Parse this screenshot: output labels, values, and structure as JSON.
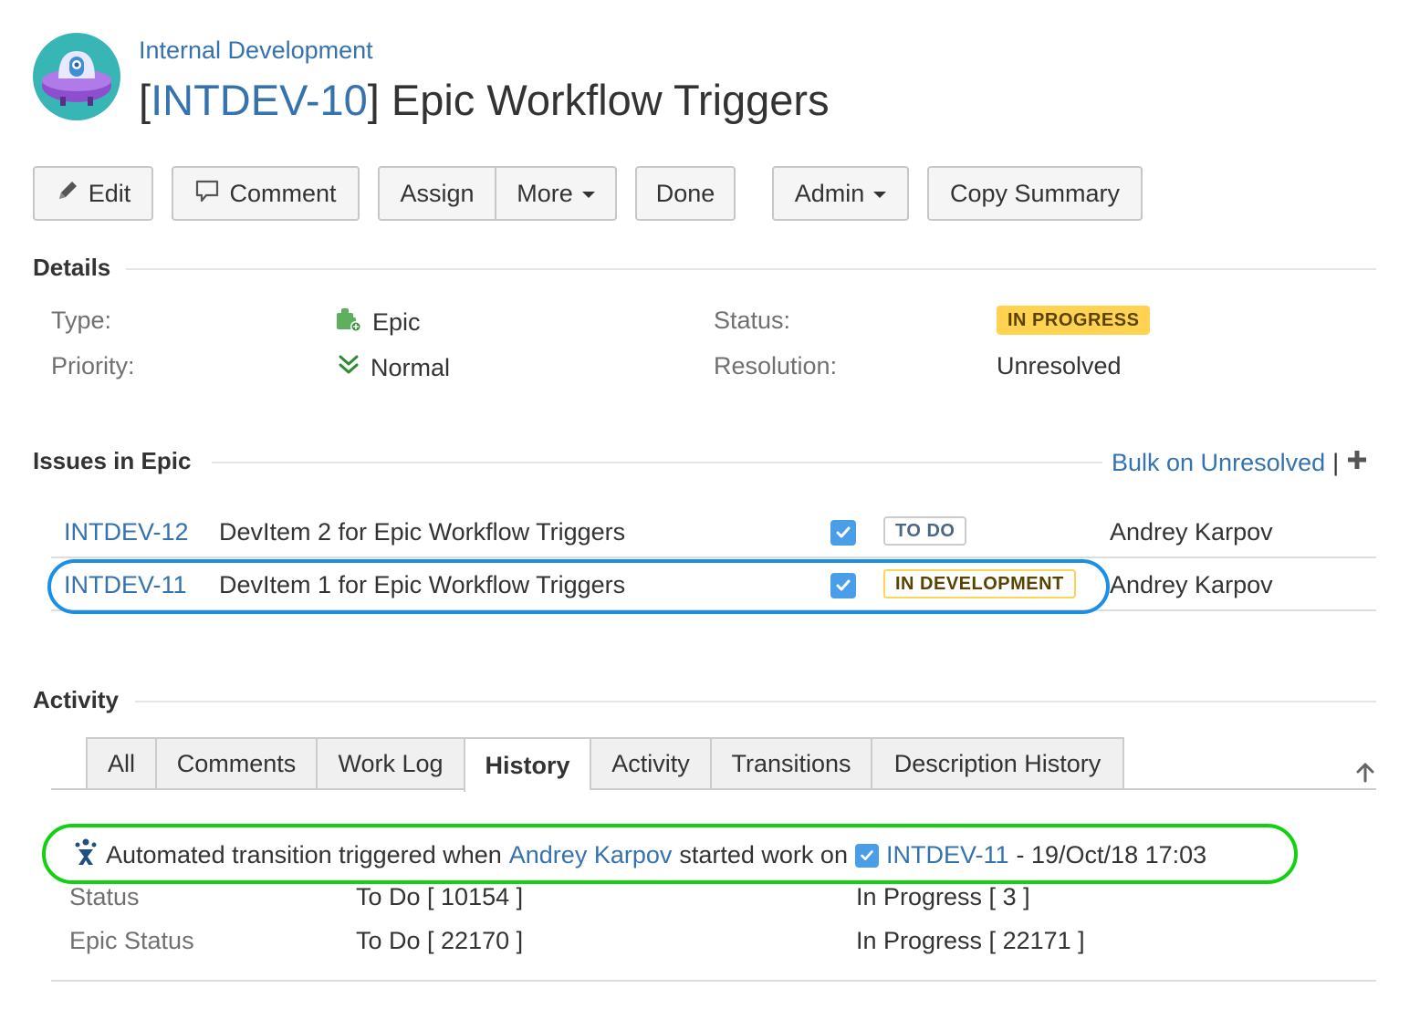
{
  "header": {
    "project_name": "Internal Development",
    "issue_key": "INTDEV-10",
    "issue_summary": " Epic Workflow Triggers",
    "bracket_open": "[",
    "bracket_close": "]"
  },
  "toolbar": {
    "edit_label": "Edit",
    "comment_label": "Comment",
    "assign_label": "Assign",
    "more_label": "More",
    "done_label": "Done",
    "admin_label": "Admin",
    "copy_summary_label": "Copy Summary"
  },
  "details": {
    "heading": "Details",
    "type_label": "Type:",
    "type_value": "Epic",
    "priority_label": "Priority:",
    "priority_value": "Normal",
    "status_label": "Status:",
    "status_value": "IN PROGRESS",
    "resolution_label": "Resolution:",
    "resolution_value": "Unresolved"
  },
  "issues_in_epic": {
    "heading": "Issues in Epic",
    "bulk_label": "Bulk on Unresolved",
    "bulk_sep": "|",
    "rows": [
      {
        "key": "INTDEV-12",
        "summary": "DevItem 2 for Epic Workflow Triggers",
        "status": "TO DO",
        "assignee": "Andrey Karpov"
      },
      {
        "key": "INTDEV-11",
        "summary": "DevItem 1 for Epic Workflow Triggers",
        "status": "IN DEVELOPMENT",
        "assignee": "Andrey Karpov"
      }
    ]
  },
  "activity": {
    "heading": "Activity",
    "tabs": [
      "All",
      "Comments",
      "Work Log",
      "History",
      "Activity",
      "Transitions",
      "Description History"
    ],
    "active_tab": "History",
    "history": {
      "text_before": "Automated transition triggered when",
      "user": "Andrey Karpov",
      "text_middle": "started work on",
      "issue_key": "INTDEV-11",
      "timestamp": "- 19/Oct/18 17:03",
      "changes": [
        {
          "field": "Status",
          "old": "To Do [ 10154 ]",
          "new": "In Progress [ 3 ]"
        },
        {
          "field": "Epic Status",
          "old": "To Do [ 22170 ]",
          "new": "In Progress [ 22171 ]"
        }
      ]
    }
  },
  "colors": {
    "link": "#3572b0",
    "in_progress": "#ffd351",
    "checkbox": "#4a9ee8",
    "highlight_blue": "#1a8fe8",
    "highlight_green": "#11d111"
  }
}
